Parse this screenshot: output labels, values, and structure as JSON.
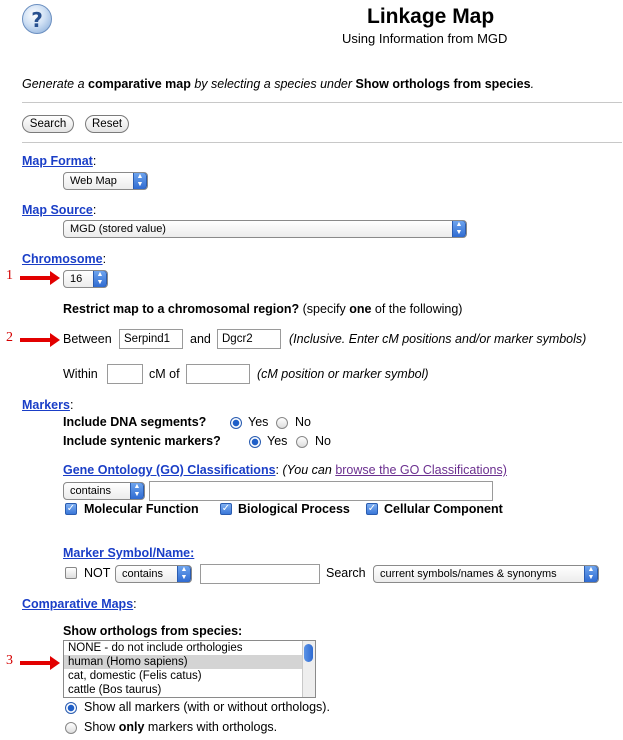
{
  "header": {
    "help_symbol": "?",
    "title": "Linkage Map",
    "subtitle": "Using Information from MGD"
  },
  "intro": {
    "part1": "Generate a ",
    "bold1": "comparative map",
    "part2": " by selecting a species under ",
    "bold2": "Show orthologs from species",
    "part3": "."
  },
  "buttons": {
    "search": "Search",
    "reset": "Reset"
  },
  "map_format": {
    "label": "Map Format",
    "value": "Web Map"
  },
  "map_source": {
    "label": "Map Source",
    "value": "MGD (stored value)"
  },
  "chromosome": {
    "label": "Chromosome",
    "value": "16"
  },
  "annotations": {
    "one": "1",
    "two": "2",
    "three": "3"
  },
  "region": {
    "heading_bold": "Restrict map to a chromosomal region?",
    "heading_pre": " (specify ",
    "heading_one": "one",
    "heading_post": " of the following)",
    "between_label": "Between",
    "between_from": "Serpind1",
    "and_label": "and",
    "between_to": "Dgcr2",
    "between_hint": "(Inclusive. Enter cM positions and/or marker symbols)",
    "within_label": "Within",
    "within_cm": "",
    "cm_of_label": "cM of",
    "within_marker": "",
    "within_hint": "(cM position or marker symbol)"
  },
  "markers": {
    "label": "Markers",
    "dna_segments_label": "Include DNA segments?",
    "syntenic_label": "Include syntenic markers?",
    "yes": "Yes",
    "no": "No",
    "dna_segments_value": "Yes",
    "syntenic_value": "Yes"
  },
  "go": {
    "label": "Gene Ontology (GO) Classifications",
    "note_pre": "(You can ",
    "note_link": "browse the GO Classifications)",
    "operator": "contains",
    "query": "",
    "molecular_function": "Molecular Function",
    "biological_process": "Biological Process",
    "cellular_component": "Cellular Component",
    "mf_checked": true,
    "bp_checked": true,
    "cc_checked": true
  },
  "marker_symbol": {
    "label": "Marker Symbol/Name:",
    "not_label": "NOT",
    "not_checked": false,
    "operator": "contains",
    "query": "",
    "search_label": "Search",
    "search_scope": "current symbols/names & synonyms"
  },
  "comparative": {
    "label": "Comparative Maps",
    "orthologs_label": "Show orthologs from species:",
    "species_options": [
      "NONE - do not include orthologies",
      "human (Homo sapiens)",
      "cat, domestic (Felis catus)",
      "cattle (Bos taurus)"
    ],
    "selected_species": "human (Homo sapiens)",
    "show_all_label": "Show all markers (with or without orthologs).",
    "show_only_pre": "Show ",
    "show_only_bold": "only",
    "show_only_post": " markers with orthologs.",
    "show_all_checked": true
  },
  "colors": {
    "link_blue": "#1a3ec7",
    "annotation_red": "#e20000",
    "visited_link": "#6b2f8f"
  }
}
